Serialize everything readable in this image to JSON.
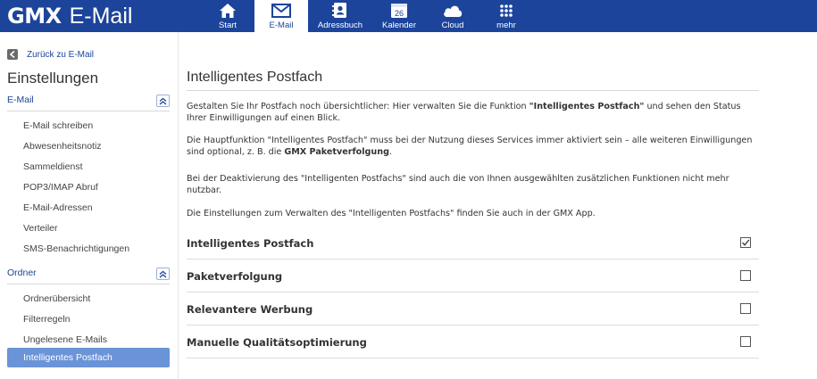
{
  "header": {
    "brand": "GMX",
    "product": "E-Mail",
    "nav": [
      {
        "label": "Start",
        "icon": "home-icon"
      },
      {
        "label": "E-Mail",
        "icon": "envelope-icon",
        "active": true
      },
      {
        "label": "Adressbuch",
        "icon": "address-book-icon"
      },
      {
        "label": "Kalender",
        "icon": "calendar-icon",
        "day": "26"
      },
      {
        "label": "Cloud",
        "icon": "cloud-icon"
      },
      {
        "label": "mehr",
        "icon": "grid-dots-icon"
      }
    ]
  },
  "sidebar": {
    "back_label": "Zurück zu E-Mail",
    "title": "Einstellungen",
    "sections": [
      {
        "name": "E-Mail",
        "items": [
          "E-Mail schreiben",
          "Abwesenheitsnotiz",
          "Sammeldienst",
          "POP3/IMAP Abruf",
          "E-Mail-Adressen",
          "Verteiler",
          "SMS-Benachrichtigungen"
        ]
      },
      {
        "name": "Ordner",
        "items": [
          "Ordnerübersicht",
          "Filterregeln",
          "Ungelesene E-Mails",
          "Intelligentes Postfach"
        ]
      }
    ],
    "active_item": "Intelligentes Postfach"
  },
  "main": {
    "title": "Intelligentes Postfach",
    "p1_before": "Gestalten Sie Ihr Postfach noch übersichtlicher: Hier verwalten Sie die Funktion ",
    "p1_bold": "\"Intelligentes Postfach\"",
    "p1_after": " und sehen den Status Ihrer Einwilligungen auf einen Blick.",
    "p2_before": "Die Hauptfunktion \"Intelligentes Postfach\" muss bei der Nutzung dieses Services immer aktiviert sein – alle weiteren Einwilligungen sind optional, z. B. die ",
    "p2_bold": "GMX Paketverfolgung",
    "p2_after": ".",
    "p3": "Bei der Deaktivierung des \"Intelligenten Postfachs\" sind auch die von Ihnen ausgewählten zusätzlichen Funktionen nicht mehr nutzbar.",
    "p4": "Die Einstellungen zum Verwalten des \"Intelligenten Postfachs\" finden Sie auch in der GMX App.",
    "options": [
      {
        "label": "Intelligentes Postfach",
        "checked": true
      },
      {
        "label": "Paketverfolgung",
        "checked": false
      },
      {
        "label": "Relevantere Werbung",
        "checked": false
      },
      {
        "label": "Manuelle Qualitätsoptimierung",
        "checked": false
      }
    ]
  },
  "colors": {
    "brand_blue": "#1c449b",
    "active_blue": "#6a93d8"
  }
}
